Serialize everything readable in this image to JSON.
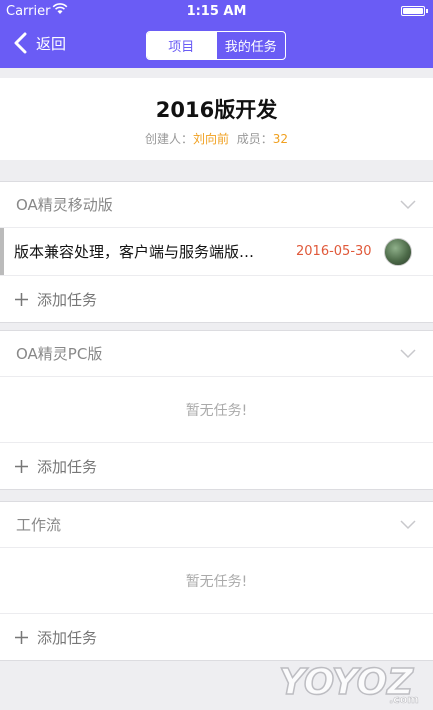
{
  "status_bar": {
    "carrier": "Carrier",
    "time": "1:15 AM"
  },
  "nav": {
    "back_label": "返回",
    "segments": [
      {
        "label": "项目",
        "active": true
      },
      {
        "label": "我的任务",
        "active": false
      }
    ],
    "accent_color": "#6a5cf5"
  },
  "project": {
    "title": "2016版开发",
    "creator_label": "创建人：",
    "creator": "刘向前",
    "members_label": "成员：",
    "members": "32"
  },
  "groups": [
    {
      "name": "OA精灵移动版",
      "tasks": [
        {
          "title": "版本兼容处理，客户端与服务端版…",
          "date": "2016-05-30"
        }
      ],
      "empty_text": "",
      "add_label": "添加任务"
    },
    {
      "name": "OA精灵PC版",
      "tasks": [],
      "empty_text": "暂无任务!",
      "add_label": "添加任务"
    },
    {
      "name": "工作流",
      "tasks": [],
      "empty_text": "暂无任务!",
      "add_label": "添加任务"
    }
  ],
  "watermark": {
    "text": "YOYOZ",
    "suffix": ".com"
  }
}
